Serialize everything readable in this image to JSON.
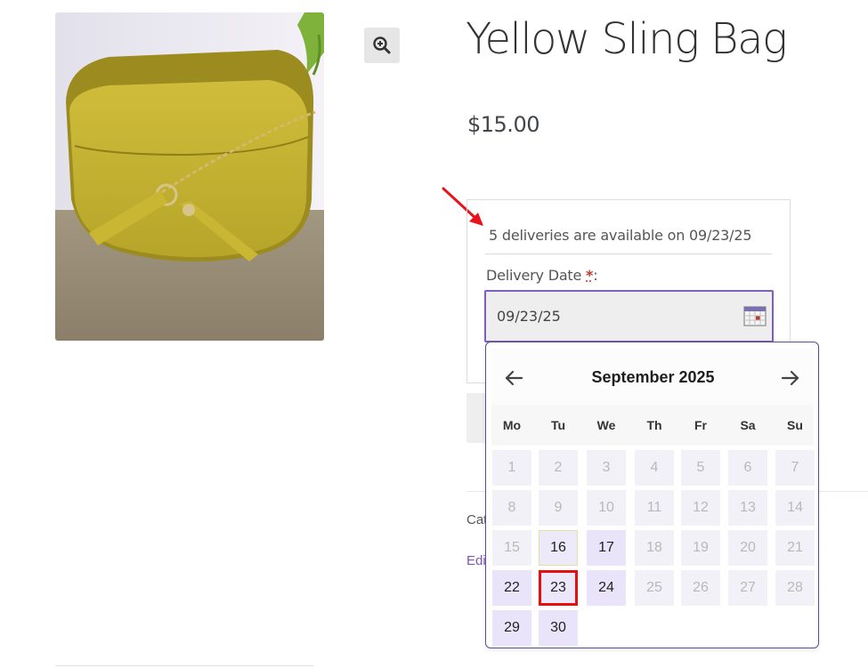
{
  "product": {
    "title": "Yellow Sling Bag",
    "price": "$15.00",
    "image_alt": "yellow half-moon sling bag with gold chain"
  },
  "delivery": {
    "availability_text": "5 deliveries are available on 09/23/25",
    "label": "Delivery Date",
    "required_mark": "*",
    "label_suffix": ":",
    "date_value": "09/23/25"
  },
  "partial_texts": {
    "category": "Categories",
    "edit": "Edit"
  },
  "calendar": {
    "prev_icon": "arrow-left-icon",
    "next_icon": "arrow-right-icon",
    "month_title": "September 2025",
    "weekdays": [
      "Mo",
      "Tu",
      "We",
      "Th",
      "Fr",
      "Sa",
      "Su"
    ],
    "weeks": [
      [
        {
          "d": "1",
          "s": "disabled"
        },
        {
          "d": "2",
          "s": "disabled"
        },
        {
          "d": "3",
          "s": "disabled"
        },
        {
          "d": "4",
          "s": "disabled"
        },
        {
          "d": "5",
          "s": "disabled"
        },
        {
          "d": "6",
          "s": "disabled"
        },
        {
          "d": "7",
          "s": "disabled"
        }
      ],
      [
        {
          "d": "8",
          "s": "disabled"
        },
        {
          "d": "9",
          "s": "disabled"
        },
        {
          "d": "10",
          "s": "disabled"
        },
        {
          "d": "11",
          "s": "disabled"
        },
        {
          "d": "12",
          "s": "disabled"
        },
        {
          "d": "13",
          "s": "disabled"
        },
        {
          "d": "14",
          "s": "disabled"
        }
      ],
      [
        {
          "d": "15",
          "s": "disabled"
        },
        {
          "d": "16",
          "s": "today"
        },
        {
          "d": "17",
          "s": "available"
        },
        {
          "d": "18",
          "s": "disabled"
        },
        {
          "d": "19",
          "s": "disabled"
        },
        {
          "d": "20",
          "s": "disabled"
        },
        {
          "d": "21",
          "s": "disabled"
        }
      ],
      [
        {
          "d": "22",
          "s": "available"
        },
        {
          "d": "23",
          "s": "selected"
        },
        {
          "d": "24",
          "s": "available"
        },
        {
          "d": "25",
          "s": "disabled"
        },
        {
          "d": "26",
          "s": "disabled"
        },
        {
          "d": "27",
          "s": "disabled"
        },
        {
          "d": "28",
          "s": "disabled"
        }
      ],
      [
        {
          "d": "29",
          "s": "available"
        },
        {
          "d": "30",
          "s": "available"
        }
      ]
    ]
  },
  "colors": {
    "accent": "#7e5fbf",
    "selected_border": "#e80e0e",
    "annotation_arrow": "#e8131b"
  }
}
